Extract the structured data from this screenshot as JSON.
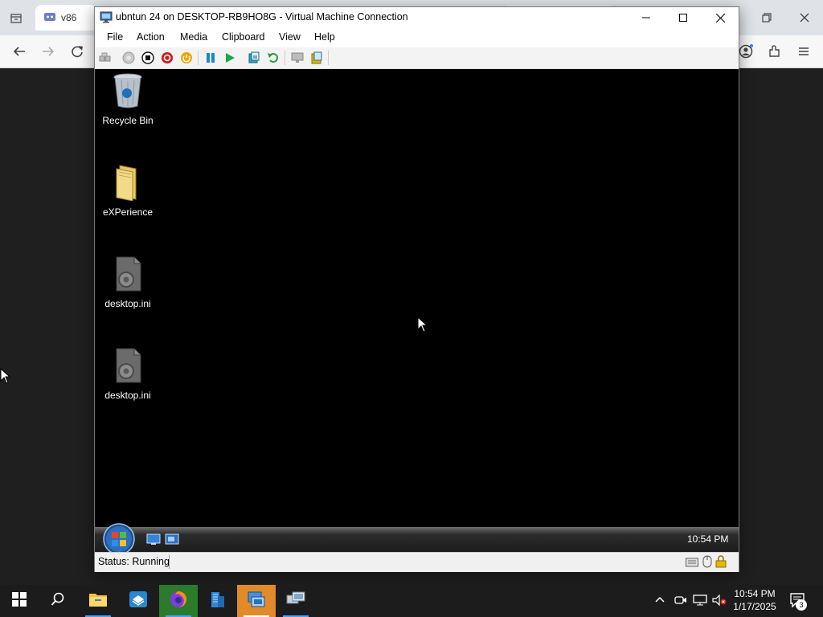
{
  "browser": {
    "tab_label": "v86",
    "nav_icons": [
      "back-arrow-icon",
      "forward-arrow-icon",
      "reload-icon"
    ],
    "right_icons": [
      "profile-icon",
      "extensions-icon",
      "menu-icon"
    ]
  },
  "vm": {
    "window_title": "ubntun 24 on DESKTOP-RB9HO8G - Virtual Machine Connection",
    "menu": [
      "File",
      "Action",
      "Media",
      "Clipboard",
      "View",
      "Help"
    ],
    "status_text": "Status: Running",
    "desktop_icons": [
      {
        "label": "Recycle Bin",
        "icon": "recycle-bin-icon"
      },
      {
        "label": "eXPerience",
        "icon": "folder-icon"
      },
      {
        "label": "desktop.ini",
        "icon": "settings-file-icon"
      },
      {
        "label": "desktop.ini",
        "icon": "settings-file-icon"
      }
    ],
    "guest_clock": "10:54 PM"
  },
  "host_taskbar": {
    "time": "10:54 PM",
    "date": "1/17/2025",
    "notification_count": "3"
  },
  "colors": {
    "accent": "#4aa3ff",
    "vm_screen": "#000000",
    "host_taskbar": "#1c1c1c"
  }
}
